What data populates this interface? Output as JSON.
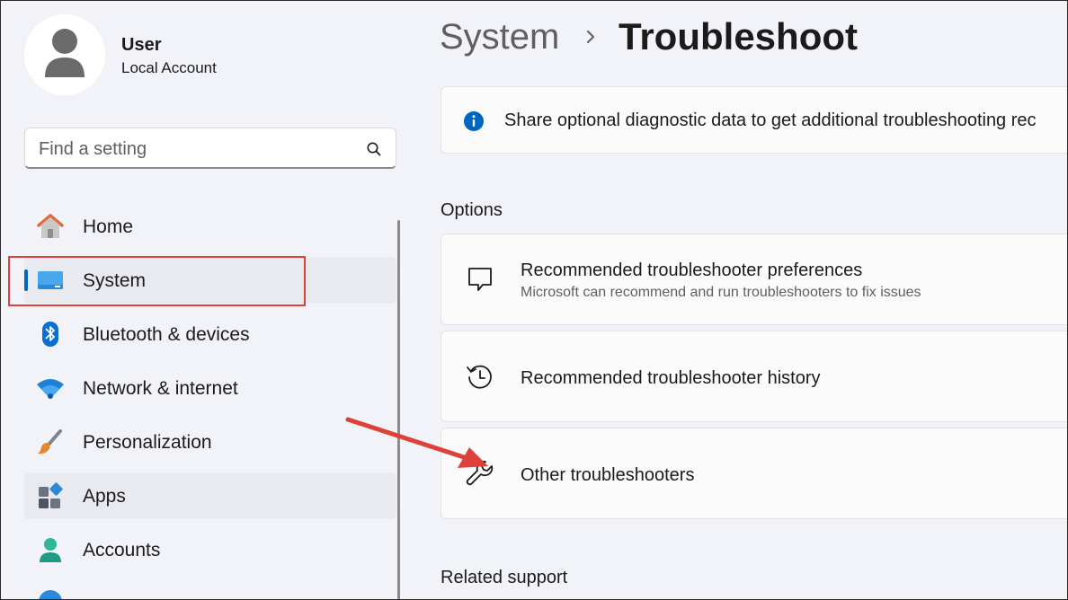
{
  "user": {
    "name": "User",
    "account_type": "Local Account"
  },
  "search": {
    "placeholder": "Find a setting"
  },
  "nav": {
    "items": [
      {
        "label": "Home",
        "icon": "home-icon"
      },
      {
        "label": "System",
        "icon": "system-display-icon",
        "active": true
      },
      {
        "label": "Bluetooth & devices",
        "icon": "bluetooth-icon"
      },
      {
        "label": "Network & internet",
        "icon": "wifi-icon"
      },
      {
        "label": "Personalization",
        "icon": "paintbrush-icon"
      },
      {
        "label": "Apps",
        "icon": "apps-icon"
      },
      {
        "label": "Accounts",
        "icon": "accounts-icon"
      }
    ]
  },
  "breadcrumb": {
    "parent": "System",
    "current": "Troubleshoot"
  },
  "info_banner": {
    "text": "Share optional diagnostic data to get additional troubleshooting rec",
    "icon": "info-icon"
  },
  "options": {
    "title": "Options",
    "items": [
      {
        "title": "Recommended troubleshooter preferences",
        "subtitle": "Microsoft can recommend and run troubleshooters to fix issues",
        "icon": "chat-bubble-icon"
      },
      {
        "title": "Recommended troubleshooter history",
        "icon": "history-icon"
      },
      {
        "title": "Other troubleshooters",
        "icon": "wrench-icon"
      }
    ]
  },
  "related_support": {
    "title": "Related support"
  },
  "colors": {
    "accent": "#0067c0",
    "annotation": "#e0403a"
  }
}
